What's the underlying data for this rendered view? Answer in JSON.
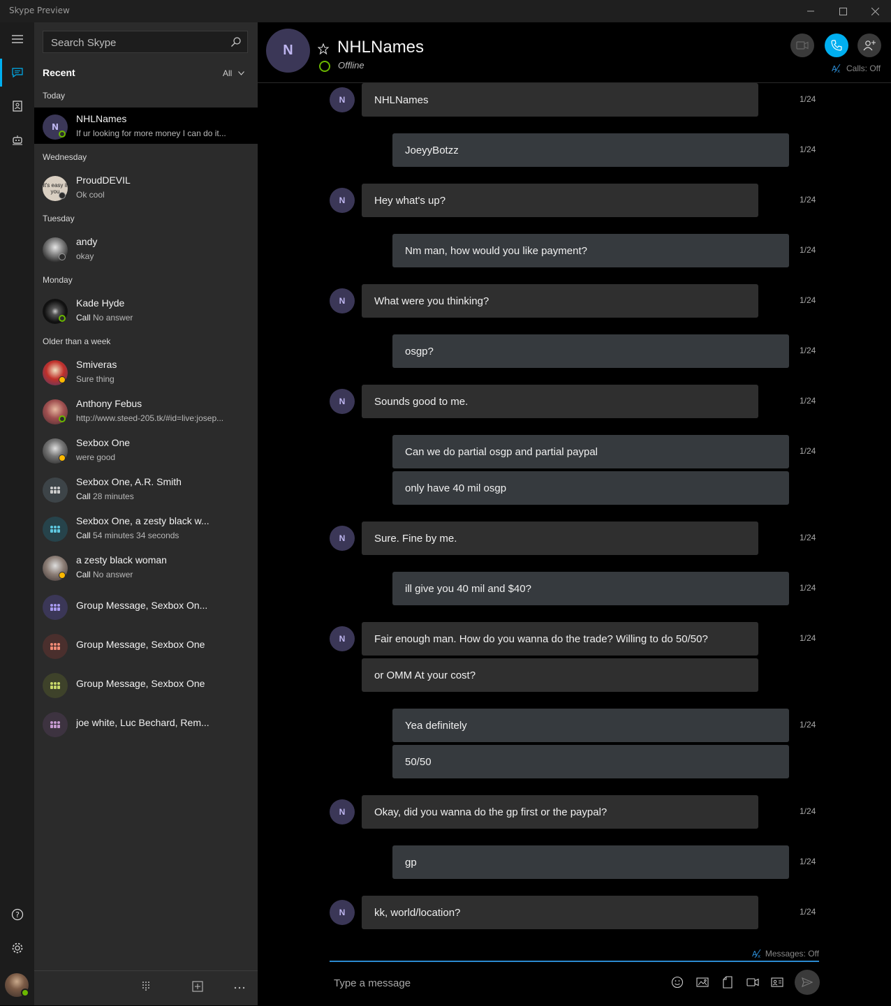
{
  "window": {
    "title": "Skype Preview"
  },
  "search": {
    "placeholder": "Search Skype"
  },
  "recent": {
    "header": "Recent",
    "filter": "All"
  },
  "sections": {
    "today": "Today",
    "wednesday": "Wednesday",
    "tuesday": "Tuesday",
    "monday": "Monday",
    "older": "Older than a week"
  },
  "contacts": [
    {
      "name": "NHLNames",
      "initial": "N",
      "message": "If ur looking for more money I can do it...",
      "status": "online"
    },
    {
      "name": "ProudDEVIL",
      "message": "Ok cool",
      "status": "unknown",
      "avatar_text": "It's easy if you"
    },
    {
      "name": "andy",
      "message": "okay",
      "status": "unknown"
    },
    {
      "name": "Kade Hyde",
      "label": "Call",
      "message": "No answer",
      "status": "online"
    },
    {
      "name": "Smiveras",
      "message": "Sure thing",
      "status": "away"
    },
    {
      "name": "Anthony Febus",
      "message": "http://www.steed-205.tk/#id=live:josep...",
      "status": "online"
    },
    {
      "name": "Sexbox One",
      "message": "were good",
      "status": "away"
    },
    {
      "name": "Sexbox One, A.R. Smith",
      "label": "Call",
      "message": "28 minutes",
      "status": "group"
    },
    {
      "name": "Sexbox One, a zesty black w...",
      "label": "Call",
      "message": "54 minutes 34 seconds",
      "status": "group"
    },
    {
      "name": "a zesty black woman",
      "label": "Call",
      "message": "No answer",
      "status": "away"
    },
    {
      "name": "Group Message, Sexbox On...",
      "status": "group"
    },
    {
      "name": "Group Message, Sexbox One",
      "status": "group"
    },
    {
      "name": "Group Message, Sexbox One",
      "status": "group"
    },
    {
      "name": "joe white, Luc Bechard, Rem...",
      "status": "group"
    }
  ],
  "chat": {
    "initial": "N",
    "name": "NHLNames",
    "status": "Offline",
    "calls_label": "Calls: Off",
    "messages": [
      {
        "side": "in",
        "text": "NHLNames",
        "date": "1/24"
      },
      {
        "side": "out",
        "text": "JoeyyBotzz",
        "date": "1/24"
      },
      {
        "side": "in",
        "text": "Hey what's up?",
        "date": "1/24"
      },
      {
        "side": "out",
        "text": "Nm man, how would you like payment?",
        "date": "1/24"
      },
      {
        "side": "in",
        "text": "What were you thinking?",
        "date": "1/24"
      },
      {
        "side": "out",
        "text": "osgp?",
        "date": "1/24"
      },
      {
        "side": "in",
        "text": "Sounds good to me.",
        "date": "1/24"
      },
      {
        "side": "out",
        "text": "Can we do partial osgp and partial paypal",
        "date": "1/24"
      },
      {
        "side": "out",
        "text": "only have 40 mil osgp",
        "date": ""
      },
      {
        "side": "in",
        "text": "Sure. Fine by me.",
        "date": "1/24"
      },
      {
        "side": "out",
        "text": "ill give you 40 mil and $40?",
        "date": "1/24"
      },
      {
        "side": "in",
        "text": "Fair enough man. How do you wanna do the trade? Willing to do 50/50?",
        "date": "1/24"
      },
      {
        "side": "in",
        "text": "or OMM At your cost?",
        "date": ""
      },
      {
        "side": "out",
        "text": "Yea definitely",
        "date": "1/24"
      },
      {
        "side": "out",
        "text": "50/50",
        "date": ""
      },
      {
        "side": "in",
        "text": "Okay, did you wanna do the gp first or the paypal?",
        "date": "1/24"
      },
      {
        "side": "out",
        "text": "gp",
        "date": "1/24"
      },
      {
        "side": "in",
        "text": "kk, world/location?",
        "date": "1/24"
      }
    ]
  },
  "compose": {
    "placeholder": "Type a message",
    "messages_label": "Messages: Off"
  },
  "icons": {
    "menu": "hamburger-icon",
    "chats": "chat-icon",
    "contacts": "contacts-book-icon",
    "bots": "bot-icon",
    "help": "help-icon",
    "settings": "gear-icon"
  },
  "colors": {
    "accent": "#00aff0",
    "online": "#6bb700",
    "away": "#ffb900",
    "avatar_bg": "#3b3757"
  }
}
